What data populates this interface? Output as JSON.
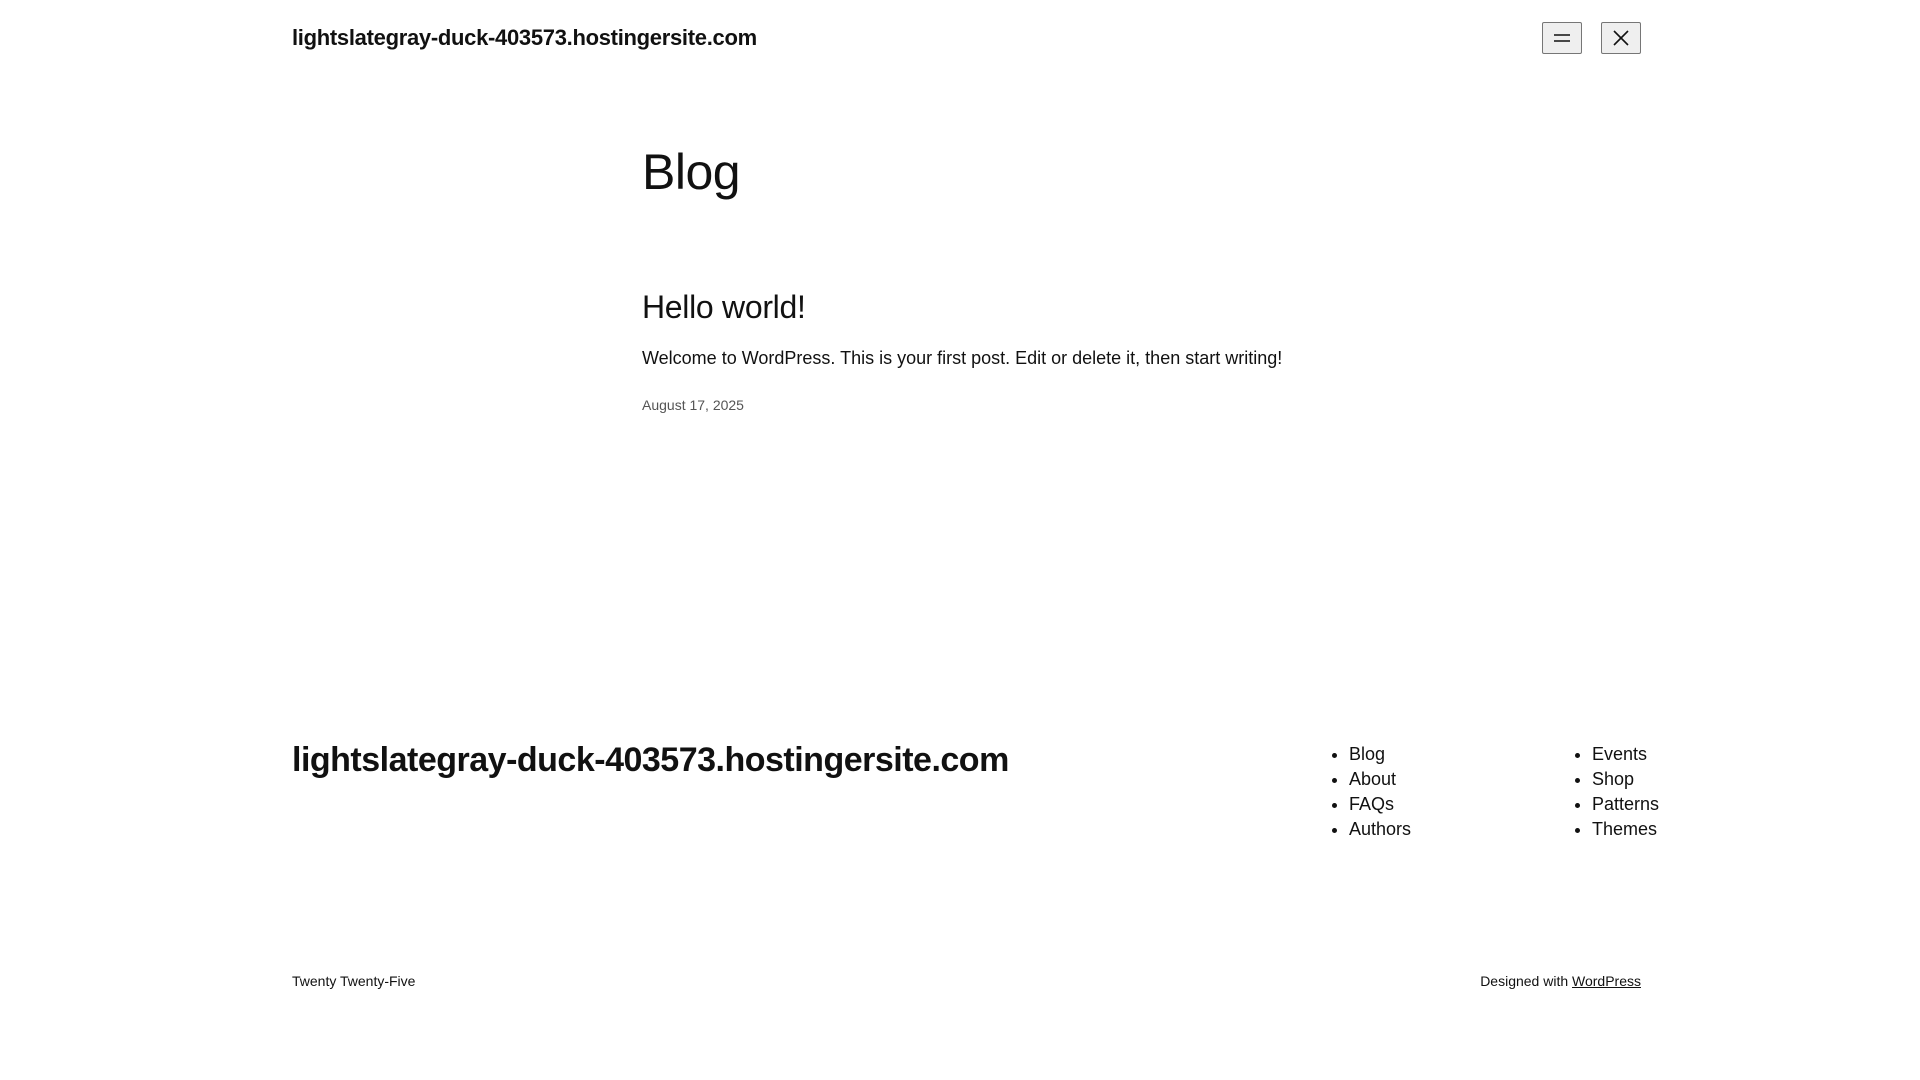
{
  "header": {
    "site_title": "lightslategray-duck-403573.hostingersite.com",
    "menu_icon": "menu-icon",
    "close_icon": "close-icon"
  },
  "main": {
    "heading": "Blog",
    "post": {
      "title": "Hello world!",
      "excerpt": "Welcome to WordPress. This is your first post. Edit or delete it, then start writing!",
      "date": "August 17, 2025"
    }
  },
  "footer": {
    "site_title": "lightslategray-duck-403573.hostingersite.com",
    "nav_col1": [
      "Blog",
      "About",
      "FAQs",
      "Authors"
    ],
    "nav_col2": [
      "Events",
      "Shop",
      "Patterns",
      "Themes"
    ],
    "theme_name": "Twenty Twenty-Five",
    "designed_with": "Designed with",
    "wordpress_link": "WordPress"
  }
}
